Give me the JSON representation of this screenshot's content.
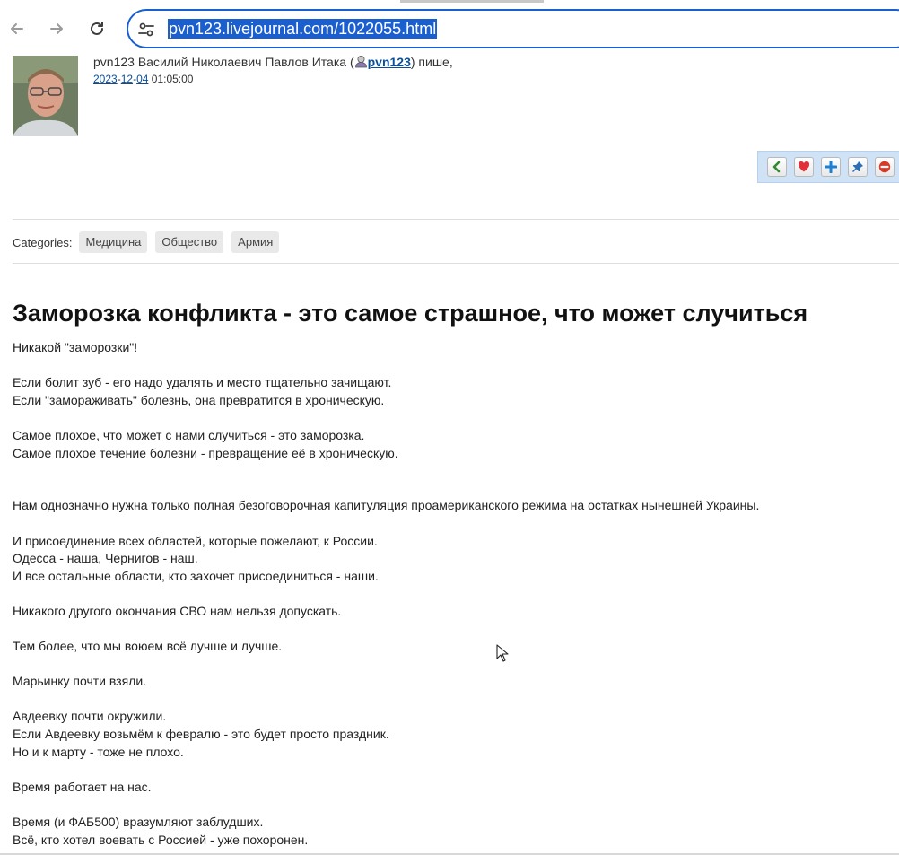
{
  "browser": {
    "url": "pvn123.livejournal.com/1022055.html",
    "back_icon": "arrow-left-icon",
    "forward_icon": "arrow-right-icon",
    "reload_icon": "reload-icon",
    "site_info_icon": "tune-icon"
  },
  "post_header": {
    "author_text": "pvn123 Василий Николаевич Павлов Итака (",
    "username": "pvn123",
    "author_suffix": ") пише,",
    "date_year": "2023",
    "date_month": "12",
    "date_day": "04",
    "date_sep": "-",
    "time": "01:05:00"
  },
  "actions": [
    {
      "name": "back",
      "icon": "chevron-left-icon",
      "color": "#2e8b2e"
    },
    {
      "name": "like",
      "icon": "heart-icon",
      "color": "#e0303a"
    },
    {
      "name": "add",
      "icon": "plus-icon",
      "color": "#1f7fd0"
    },
    {
      "name": "pin",
      "icon": "pin-icon",
      "color": "#2a6fb5"
    },
    {
      "name": "block",
      "icon": "minus-circle-icon",
      "color": "#d83a2a"
    }
  ],
  "categories": {
    "label": "Categories:",
    "tags": [
      "Медицина",
      "Общество",
      "Армия"
    ]
  },
  "post": {
    "title": "Заморозка конфликта - это самое страшное, что может случиться",
    "lines": {
      "l1": "Никакой \"заморозки\"!",
      "l2": "Если болит зуб - его надо удалять и место тщательно зачищают.",
      "l3": "Если \"замораживать\" болезнь, она превратится в хроническую.",
      "l4": "Самое плохое, что может с нами случиться - это заморозка.",
      "l5": "Самое плохое течение болезни - превращение её в хроническую.",
      "l6": "Нам однозначно нужна только полная безоговорочная капитуляция проамериканского режима на остатках нынешней Украины.",
      "l7": "И присоединение всех областей, которые пожелают, к России.",
      "l8": "Одесса - наша, Чернигов - наш.",
      "l9": "И все остальные области, кто захочет присоединиться - наши.",
      "l10": "Никакого другого окончания СВО нам нельзя допускать.",
      "l11": "Тем более, что мы воюем всё лучше и лучше.",
      "l12": "Марьинку почти взяли.",
      "l13": "Авдеевку почти окружили.",
      "l14": "Если Авдеевку возьмём к февралю - это будет просто праздник.",
      "l15": "Но и к марту - тоже не плохо.",
      "l16": "Время работает на нас.",
      "l17": "Время (и ФАБ500) вразумляют заблудших.",
      "l18": "Всё, кто хотел воевать с Россией - уже похоронен."
    }
  }
}
